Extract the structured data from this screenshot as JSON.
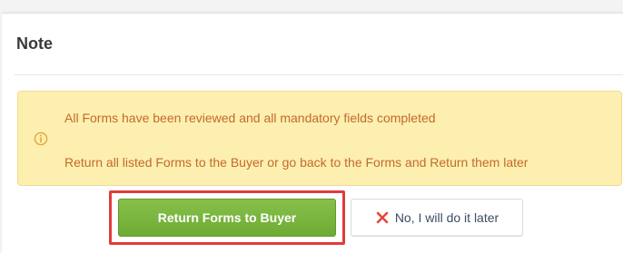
{
  "note": {
    "title": "Note",
    "alert": {
      "icon": "info-circle-icon",
      "line1": "All Forms have been reviewed and all mandatory fields completed",
      "line2": "Return all listed Forms to the Buyer or go back to the Forms and Return them later",
      "background_color": "#fcefb0",
      "text_color": "#c46a2a"
    }
  },
  "actions": {
    "primary_label": "Return Forms to Buyer",
    "primary_color": "#7ab542",
    "secondary_label": "No, I will do it later",
    "secondary_icon": "close-x-icon",
    "secondary_icon_color": "#e4473d",
    "highlight_color": "#e23b3b"
  }
}
